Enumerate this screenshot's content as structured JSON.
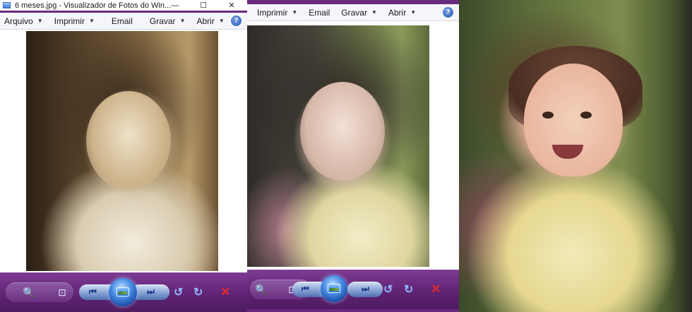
{
  "window1": {
    "title": "6 meses.jpg - Visualizador de Fotos do Win...",
    "controls": {
      "minimize": "—",
      "maximize": "☐",
      "close": "✕"
    },
    "menu": [
      {
        "label": "Arquivo",
        "dropdown": true
      },
      {
        "label": "Imprimir",
        "dropdown": true
      },
      {
        "label": "Email",
        "dropdown": false
      },
      {
        "label": "Gravar",
        "dropdown": true
      },
      {
        "label": "Abrir",
        "dropdown": true
      }
    ],
    "help": "?"
  },
  "window2": {
    "menu": [
      {
        "label": "Imprimir",
        "dropdown": true
      },
      {
        "label": "Email",
        "dropdown": false
      },
      {
        "label": "Gravar",
        "dropdown": true
      },
      {
        "label": "Abrir",
        "dropdown": true
      }
    ],
    "help": "?"
  },
  "toolbar_icons": {
    "zoom": "zoom-icon",
    "fit": "actual-size-icon",
    "previous": "previous-icon",
    "slideshow": "slideshow-icon",
    "next": "next-icon",
    "rotate_ccw": "rotate-counterclockwise-icon",
    "rotate_cw": "rotate-clockwise-icon",
    "delete": "delete-icon"
  },
  "glyphs": {
    "arrow": "▼",
    "prev": "⏮",
    "next": "⏭",
    "rotate_ccw": "↺",
    "rotate_cw": "↻",
    "delete": "✕",
    "zoom": "🔍",
    "fit": "⊡"
  },
  "colors": {
    "frame": "#6a2a7d",
    "toolbar_top": "#7d3c93",
    "toolbar_bottom": "#4e1b60",
    "menubar": "#f5f6fa",
    "accent_blue": "#2a5db4",
    "delete_red": "#e02a2a"
  }
}
